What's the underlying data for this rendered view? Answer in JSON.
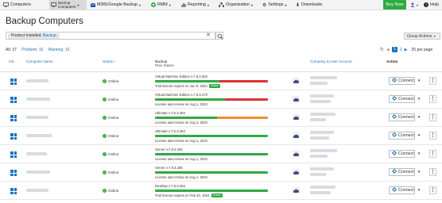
{
  "nav": {
    "computers": "Computers",
    "backup_computers_l1": "Backup",
    "backup_computers_l2": "Computers",
    "m365": "M365/Google Backup",
    "rmm": "RMM",
    "reporting": "Reporting",
    "organization": "Organization",
    "settings": "Settings",
    "downloads": "Downloads",
    "buy_now": "Buy Now",
    "help": "Help"
  },
  "page_title": "Backup Computers",
  "filter": {
    "label": "Product Installed:",
    "value": "Backup"
  },
  "group_actions": "Group Actions",
  "counts": {
    "all": "All: 37",
    "problem": "Problem: 10",
    "warning": "Warning: 16"
  },
  "pager": {
    "page1": "1",
    "page2": "2",
    "per_page": "25 per page"
  },
  "columns": {
    "os": "OS",
    "computer_name": "Computer Name",
    "status": "Status",
    "backup": "Backup",
    "plan_status": "Plan Status",
    "company": "Company & User Account",
    "action": "Action"
  },
  "rows": [
    {
      "status": "Online",
      "plan": "Virtual Machine Edition v.7.8.3.284",
      "license": "Trial license expires on Jun 8, 2023",
      "grace": "Grace",
      "connect": "Connect"
    },
    {
      "status": "Online",
      "plan": "Virtual Machine Edition v.7.8.3.270",
      "license": "License auto-renew on Aug 1, 2023",
      "grace": "",
      "connect": "Connect"
    },
    {
      "status": "Online",
      "plan": "Ultimate v.7.8.3.284",
      "license": "License auto-renew on Aug 3, 2023",
      "grace": "",
      "connect": "Connect"
    },
    {
      "status": "Online",
      "plan": "Ultimate v.7.8.3.284",
      "license": "License auto-renew on Aug 1, 2023",
      "grace": "",
      "connect": "Connect"
    },
    {
      "status": "Online",
      "plan": "Server v.7.8.3.284",
      "license": "License auto-renew on Aug 1, 2023",
      "grace": "",
      "connect": "Connect"
    },
    {
      "status": "Online",
      "plan": "Server v.7.8.3.286",
      "license": "License auto-renew on Aug 1, 2023",
      "grace": "",
      "connect": "Connect"
    },
    {
      "status": "Online",
      "plan": "Desktop v.7.8.3.284",
      "license": "Trial license expires on Feb 10, 2024",
      "grace": "Grace",
      "connect": "Connect"
    }
  ],
  "colors": {
    "accent": "#1e73be",
    "green": "#2eaa43",
    "red": "#e03131",
    "orange": "#f08c2e"
  }
}
